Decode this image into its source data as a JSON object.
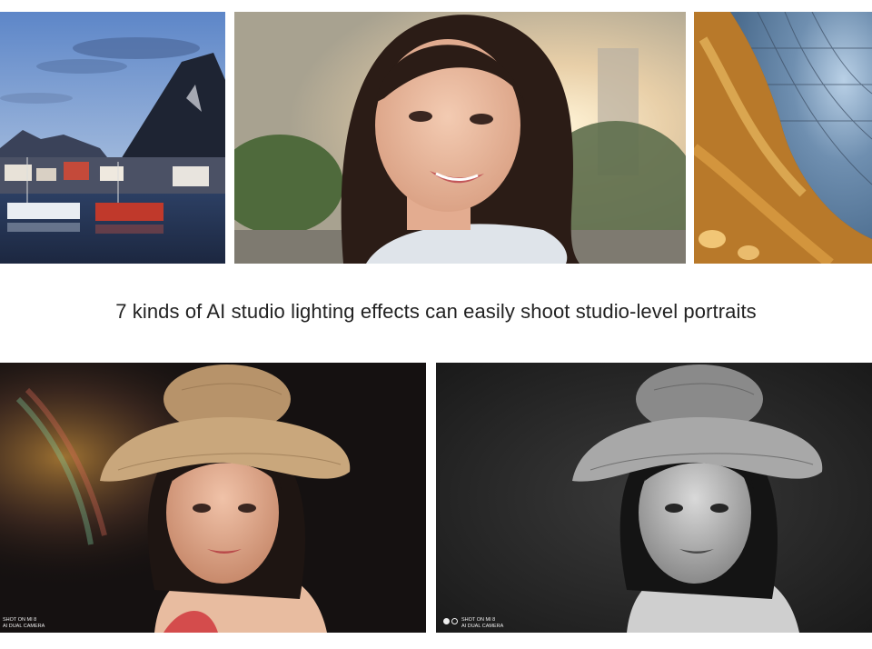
{
  "caption": "7 kinds of AI studio lighting effects can easily shoot studio-level portraits",
  "photos": {
    "harbor": "harbor-village-at-dusk",
    "sunset_portrait": "smiling-woman-sunset",
    "dome": "ornate-glass-dome",
    "color_portrait": "woman-in-straw-hat-color",
    "bw_portrait": "woman-in-straw-hat-monochrome"
  },
  "watermarks": {
    "left": {
      "line1": "SHOT ON MI 8",
      "line2": "AI DUAL CAMERA"
    },
    "right": {
      "line1": "SHOT ON MI 8",
      "line2": "AI DUAL CAMERA"
    }
  }
}
